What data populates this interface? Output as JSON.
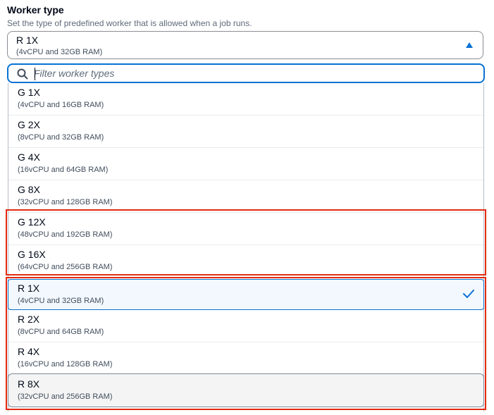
{
  "field": {
    "label": "Worker type",
    "description": "Set the type of predefined worker that is allowed when a job runs.",
    "selected_name": "R 1X",
    "selected_detail": "(4vCPU and 32GB RAM)"
  },
  "filter": {
    "placeholder": "Filter worker types",
    "value": ""
  },
  "options": [
    {
      "name": "G 1X",
      "detail": "(4vCPU and 16GB RAM)"
    },
    {
      "name": "G 2X",
      "detail": "(8vCPU and 32GB RAM)"
    },
    {
      "name": "G 4X",
      "detail": "(16vCPU and 64GB RAM)"
    },
    {
      "name": "G 8X",
      "detail": "(32vCPU and 128GB RAM)"
    },
    {
      "name": "G 12X",
      "detail": "(48vCPU and 192GB RAM)"
    },
    {
      "name": "G 16X",
      "detail": "(64vCPU and 256GB RAM)"
    },
    {
      "name": "R 1X",
      "detail": "(4vCPU and 32GB RAM)",
      "selected": true
    },
    {
      "name": "R 2X",
      "detail": "(8vCPU and 64GB RAM)"
    },
    {
      "name": "R 4X",
      "detail": "(16vCPU and 128GB RAM)"
    },
    {
      "name": "R 8X",
      "detail": "(32vCPU and 256GB RAM)"
    }
  ],
  "colors": {
    "accent": "#0972d3",
    "highlight": "#e22a11",
    "selected_bg": "#f2f8fd"
  },
  "icons": {
    "filter": "search-icon",
    "selected": "check-icon",
    "toggle": "caret-up-icon"
  }
}
